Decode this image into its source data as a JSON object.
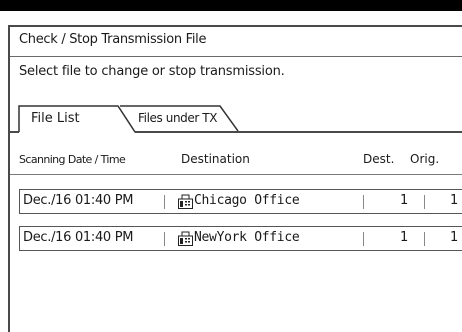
{
  "window": {
    "title": "Check / Stop Transmission File",
    "instruction": "Select file to change or stop transmission."
  },
  "tabs": [
    {
      "label": "File List",
      "selected": true
    },
    {
      "label": "Files under TX",
      "selected": false
    }
  ],
  "columns": {
    "date": "Scanning Date / Time",
    "destination": "Destination",
    "dest_count": "Dest.",
    "orig_count": "Orig."
  },
  "rows": [
    {
      "date": "Dec./16  01:40 PM",
      "icon": "fax-machine-icon",
      "destination": "Chicago Office",
      "dest": "1",
      "orig": "1"
    },
    {
      "date": "Dec./16  01:40 PM",
      "icon": "fax-machine-icon",
      "destination": "NewYork Office",
      "dest": "1",
      "orig": "1"
    }
  ]
}
